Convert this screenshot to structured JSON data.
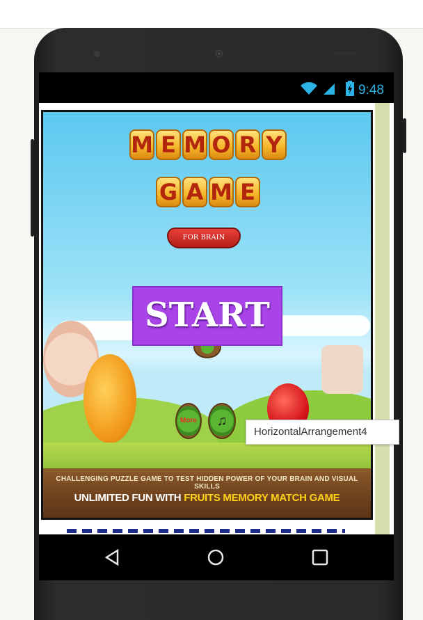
{
  "status_bar": {
    "time": "9:48",
    "icons": [
      "wifi-icon",
      "signal-icon",
      "battery-icon"
    ]
  },
  "game": {
    "title_row1": [
      "M",
      "E",
      "M",
      "O",
      "R",
      "Y"
    ],
    "title_row2": [
      "G",
      "A",
      "M",
      "E"
    ],
    "banner": "FOR BRAIN",
    "start_label": "START",
    "more_label": "More",
    "music_symbol": "♫",
    "tagline": "CHALLENGING PUZZLE GAME TO TEST HIDDEN POWER OF YOUR BRAIN AND VISUAL SKILLS",
    "slogan_prefix": "UNLIMITED FUN WITH ",
    "slogan_highlight": "FRUITS MEMORY MATCH GAME"
  },
  "tooltip": "HorizontalArrangement4",
  "nav_bar": [
    "back-icon",
    "home-icon",
    "recents-icon"
  ],
  "colors": {
    "start_button": "#a844e8",
    "status_accent": "#2bb3e6",
    "scroll_strip": "#d6deae"
  }
}
